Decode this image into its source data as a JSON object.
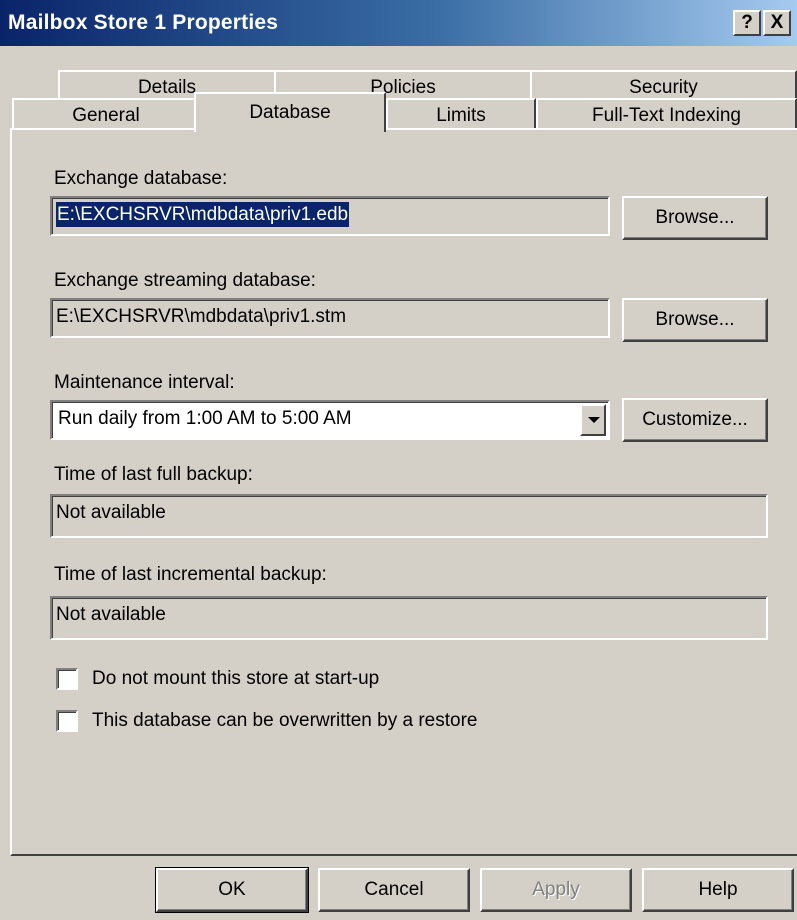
{
  "window": {
    "title": "Mailbox Store 1 Properties",
    "help_glyph": "?",
    "close_glyph": "X"
  },
  "tabs": {
    "row_back": [
      {
        "label": "Details"
      },
      {
        "label": "Policies"
      },
      {
        "label": "Security"
      }
    ],
    "row_front": [
      {
        "label": "General"
      },
      {
        "label": "Database",
        "active": true
      },
      {
        "label": "Limits"
      },
      {
        "label": "Full-Text Indexing"
      }
    ]
  },
  "database": {
    "exchange_db_label": "Exchange database:",
    "exchange_db_path": "E:\\EXCHSRVR\\mdbdata\\priv1.edb",
    "streaming_db_label": "Exchange streaming database:",
    "streaming_db_path": "E:\\EXCHSRVR\\mdbdata\\priv1.stm",
    "browse_label": "Browse...",
    "maintenance_label": "Maintenance interval:",
    "maintenance_value": "Run daily from 1:00 AM to 5:00 AM",
    "customize_label": "Customize...",
    "full_backup_label": "Time of last full backup:",
    "full_backup_value": "Not available",
    "incremental_backup_label": "Time of last incremental backup:",
    "incremental_backup_value": "Not available",
    "checkbox_no_mount": {
      "label": "Do not mount this store at start-up",
      "checked": false
    },
    "checkbox_overwrite": {
      "label": "This database can be overwritten by a restore",
      "checked": false
    }
  },
  "buttons": {
    "ok": "OK",
    "cancel": "Cancel",
    "apply": "Apply",
    "help": "Help"
  },
  "colors": {
    "titlebar_start": "#0a246a",
    "titlebar_end": "#a6caf0",
    "face": "#d4d0c8",
    "selection": "#0a246a"
  }
}
